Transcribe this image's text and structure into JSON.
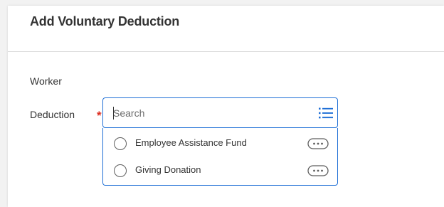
{
  "dialog": {
    "title": "Add Voluntary Deduction"
  },
  "fields": {
    "worker_label": "Worker",
    "deduction_label": "Deduction",
    "required_marker": "*"
  },
  "search": {
    "value": "",
    "placeholder": "Search",
    "icon": "list-icon"
  },
  "options": [
    {
      "label": "Employee Assistance Fund",
      "selected": false,
      "icon": "more-options-icon"
    },
    {
      "label": "Giving Donation",
      "selected": false,
      "icon": "more-options-icon"
    }
  ],
  "colors": {
    "accent": "#1f6fd6",
    "required": "#de2e21",
    "text": "#333333"
  }
}
